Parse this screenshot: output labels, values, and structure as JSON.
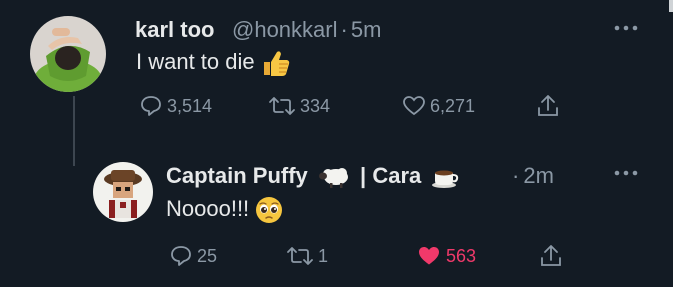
{
  "tweets": [
    {
      "display_name": "karl too",
      "handle": "@honkkarl",
      "separator": "·",
      "time": "5m",
      "text": "I want to die",
      "replies": "3,514",
      "retweets": "334",
      "likes": "6,271"
    },
    {
      "display_name": "Captain Puffy",
      "name_suffix": "| Cara",
      "separator": "·",
      "time": "2m",
      "text": "Noooo!!!",
      "replies": "25",
      "retweets": "1",
      "likes": "563"
    }
  ],
  "colors": {
    "background": "#131b24",
    "text": "#e7e9ea",
    "secondary": "#8b98a5",
    "like_active": "#f0396a"
  },
  "icons": [
    "reply-icon",
    "retweet-icon",
    "like-icon",
    "share-icon",
    "more-icon",
    "thumbs-up-emoji",
    "sheep-emoji",
    "coffee-emoji",
    "pleading-face-emoji"
  ]
}
